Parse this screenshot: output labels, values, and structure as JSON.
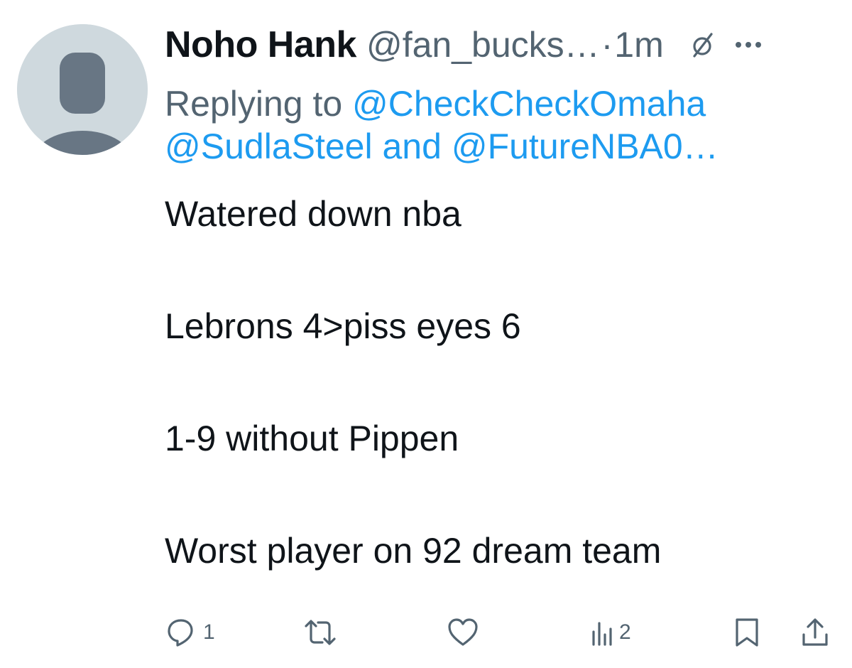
{
  "tweet": {
    "author": {
      "display_name": "Noho Hank",
      "handle": "@fan_bucks…",
      "avatar": "default-person-avatar"
    },
    "separator": "·",
    "time": "1m",
    "header_icons": [
      "grok-slash-icon",
      "more-dots-icon"
    ],
    "reply": {
      "prefix": "Replying to ",
      "mention_1": "@CheckCheckOmaha",
      "mention_2": "@SudlaSteel",
      "joiner": " and ",
      "mention_3": "@FutureNBA0…"
    },
    "text_lines": [
      "Watered down nba",
      "Lebrons 4>piss eyes 6",
      "1-9 without Pippen",
      "Worst player on 92 dream team"
    ],
    "actions": {
      "reply_count": "1",
      "repost_count": "",
      "like_count": "",
      "views_count": "2"
    }
  },
  "colors": {
    "text_primary": "#0f1419",
    "text_secondary": "#536471",
    "link": "#1d9bf0",
    "avatar_bg": "#cfd9de",
    "avatar_fg": "#687684"
  }
}
